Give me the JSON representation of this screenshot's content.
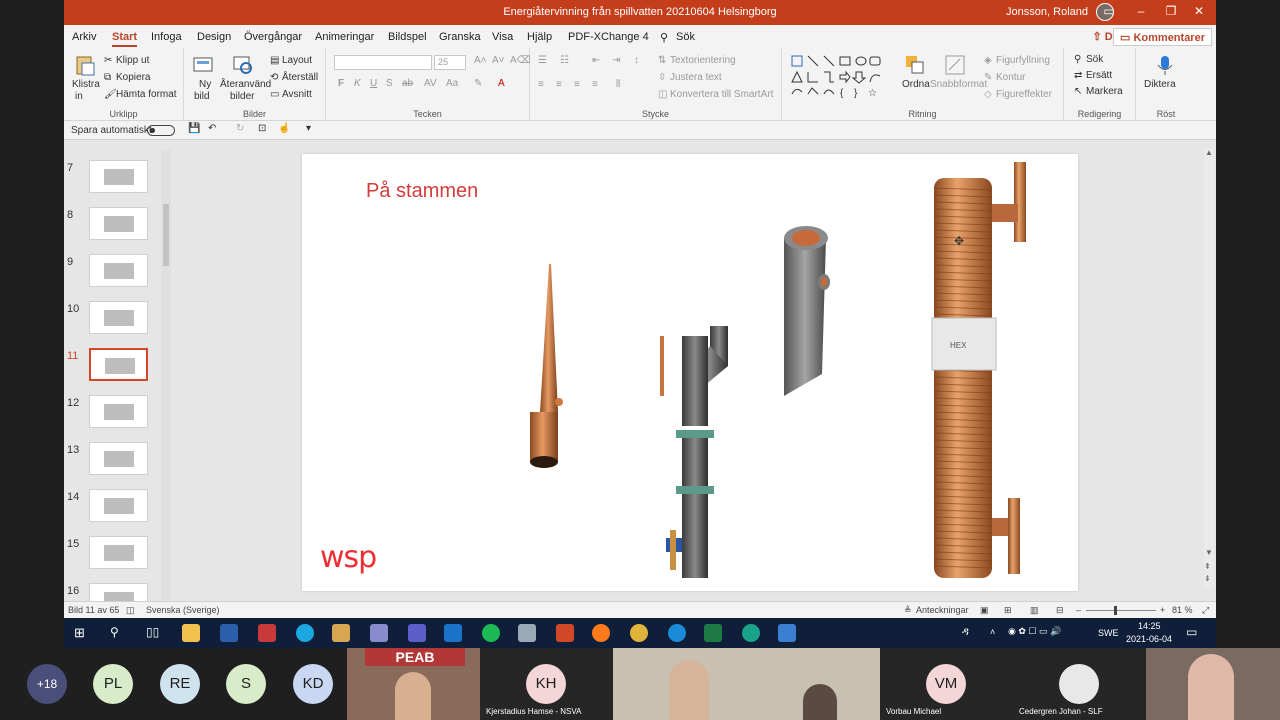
{
  "window": {
    "title": "Energiåtervinning från spillvatten 20210604 Helsingborg",
    "user": "Jonsson, Roland"
  },
  "tabs": [
    "Arkiv",
    "Start",
    "Infoga",
    "Design",
    "Övergångar",
    "Animeringar",
    "Bildspel",
    "Granska",
    "Visa",
    "Hjälp",
    "PDF-XChange 4",
    "Sök"
  ],
  "share_label": "Dela",
  "comments_label": "Kommentarer",
  "ribbon": {
    "clipboard": {
      "paste": "Klistra",
      "paste2": "in",
      "cut": "Klipp ut",
      "copy": "Kopiera",
      "format_painter": "Hämta format",
      "label": "Urklipp"
    },
    "slides": {
      "new": "Ny",
      "new2": "bild",
      "reuse": "Återanvänd",
      "reuse2": "bilder",
      "layout": "Layout",
      "reset": "Återställ",
      "section": "Avsnitt",
      "label": "Bilder"
    },
    "font": {
      "size": "25",
      "bold": "F",
      "italic": "K",
      "underline": "U",
      "strike": "S",
      "shadow": "ab",
      "label": "Tecken"
    },
    "paragraph": {
      "text_direction": "Textorientering",
      "align_text": "Justera text",
      "smartart": "Konvertera till SmartArt",
      "label": "Stycke"
    },
    "drawing": {
      "arrange": "Ordna",
      "quick_styles": "Snabbformat",
      "fill": "Figurfyllning",
      "outline": "Kontur",
      "effects": "Figureffekter",
      "label": "Ritning"
    },
    "editing": {
      "find": "Sök",
      "replace": "Ersätt",
      "select": "Markera",
      "label": "Redigering"
    },
    "voice": {
      "dictate": "Diktera",
      "label": "Röst"
    }
  },
  "qat": {
    "autosave": "Spara automatiskt"
  },
  "thumbnails": [
    {
      "num": "7"
    },
    {
      "num": "8"
    },
    {
      "num": "9"
    },
    {
      "num": "10"
    },
    {
      "num": "11"
    },
    {
      "num": "12"
    },
    {
      "num": "13"
    },
    {
      "num": "14"
    },
    {
      "num": "15"
    },
    {
      "num": "16"
    }
  ],
  "slide": {
    "title": "På stammen",
    "logo": "wsp"
  },
  "status": {
    "slide_count": "Bild 11 av 65",
    "language": "Svenska (Sverige)",
    "notes": "Anteckningar",
    "zoom": "81 %"
  },
  "taskbar": {
    "lang": "SWE",
    "time": "14:25",
    "date": "2021-06-04"
  },
  "gallery": {
    "more": "+18",
    "participants": [
      {
        "initials": "PL",
        "color": "#d9ecc9"
      },
      {
        "initials": "RE",
        "color": "#cfe3ee"
      },
      {
        "initials": "S",
        "color": "#d9ecc9"
      },
      {
        "initials": "KD",
        "color": "#c9d7f2"
      }
    ],
    "video_tiles": [
      {
        "name": ""
      },
      {
        "initials": "KH",
        "name": "Kjerstadius Hamse - NSVA",
        "color": "#f4d5d8"
      },
      {
        "name": ""
      },
      {
        "initials": "VM",
        "name": "Vorbau Michael",
        "color": "#f4d5d8"
      },
      {
        "name": "Cedergren Johan - SLF"
      },
      {
        "name": ""
      }
    ],
    "peab_logo": "PEAB"
  },
  "colors": {
    "ppt_accent": "#c43e1c",
    "title_red": "#d43b3b",
    "wsp_red": "#ee2e33",
    "copper": "#c8743e"
  }
}
